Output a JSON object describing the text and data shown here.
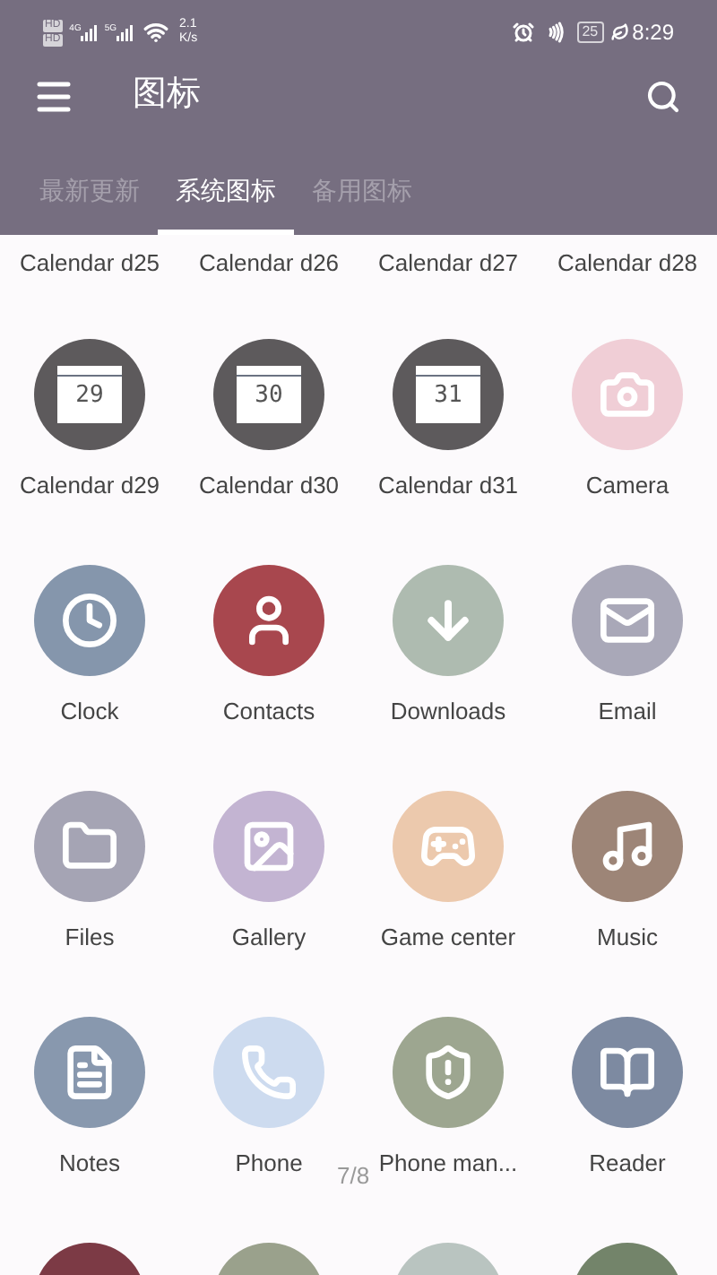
{
  "status_bar": {
    "sim_labels": [
      "HD",
      "HD"
    ],
    "network_labels": [
      "4G",
      "5G"
    ],
    "speed_value": "2.1",
    "speed_unit": "K/s",
    "battery": "25",
    "time": "8:29"
  },
  "toolbar": {
    "title": "图标"
  },
  "tabs": [
    {
      "label": "最新更新",
      "selected": false
    },
    {
      "label": "系统图标",
      "selected": true
    },
    {
      "label": "备用图标",
      "selected": false
    }
  ],
  "partial_labels": [
    "Calendar d25",
    "Calendar d26",
    "Calendar d27",
    "Calendar d28"
  ],
  "icons": [
    {
      "kind": "calendar",
      "glyph_text": "29",
      "label": "Calendar d29",
      "color": "#5d5a5c"
    },
    {
      "kind": "calendar",
      "glyph_text": "30",
      "label": "Calendar d30",
      "color": "#5d5a5c"
    },
    {
      "kind": "calendar",
      "glyph_text": "31",
      "label": "Calendar d31",
      "color": "#5d5a5c"
    },
    {
      "kind": "camera",
      "label": "Camera",
      "color": "#f0ced6"
    },
    {
      "kind": "clock",
      "label": "Clock",
      "color": "#8596ac"
    },
    {
      "kind": "contacts",
      "label": "Contacts",
      "color": "#a8474e"
    },
    {
      "kind": "download",
      "label": "Downloads",
      "color": "#aebbb0"
    },
    {
      "kind": "email",
      "label": "Email",
      "color": "#a9a8b8"
    },
    {
      "kind": "folder",
      "label": "Files",
      "color": "#a5a4b4"
    },
    {
      "kind": "gallery",
      "label": "Gallery",
      "color": "#c3b4d2"
    },
    {
      "kind": "game",
      "label": "Game center",
      "color": "#ecc9ad"
    },
    {
      "kind": "music",
      "label": "Music",
      "color": "#9d8577"
    },
    {
      "kind": "notes",
      "label": "Notes",
      "color": "#8898ae"
    },
    {
      "kind": "phone",
      "label": "Phone",
      "color": "#cddbef"
    },
    {
      "kind": "shield",
      "label": "Phone man...",
      "color": "#9da690"
    },
    {
      "kind": "book",
      "label": "Reader",
      "color": "#7d8aa1"
    }
  ],
  "partial_icons": [
    {
      "color": "#7c3a45"
    },
    {
      "color": "#9aa18c"
    },
    {
      "color": "#b9c4c0"
    },
    {
      "color": "#73846a"
    }
  ],
  "page_indicator": "7/8"
}
